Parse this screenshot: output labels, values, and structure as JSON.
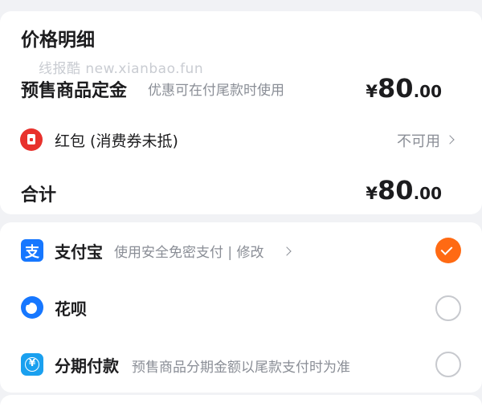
{
  "price_detail": {
    "title": "价格明细",
    "watermark": "线报酷 new.xianbao.fun",
    "deposit": {
      "label": "预售商品定金",
      "hint": "优惠可在付尾款时使用",
      "currency": "¥",
      "amount_int": "80",
      "amount_dec": ".00"
    },
    "red_packet": {
      "label": "红包 (消费券未抵)",
      "status": "不可用"
    },
    "total": {
      "label": "合计",
      "currency": "¥",
      "amount_int": "80",
      "amount_dec": ".00"
    }
  },
  "payment_methods": [
    {
      "name": "支付宝",
      "desc": "使用安全免密支付 | 修改",
      "selected": true,
      "icon": "alipay-icon"
    },
    {
      "name": "花呗",
      "desc": "",
      "selected": false,
      "icon": "huabei-icon"
    },
    {
      "name": "分期付款",
      "desc": "预售商品分期金额以尾款支付时为准",
      "selected": false,
      "icon": "installment-icon"
    }
  ],
  "colors": {
    "accent": "#ff6a13",
    "alipay_blue": "#1677ff",
    "red_packet": "#e8312c"
  }
}
